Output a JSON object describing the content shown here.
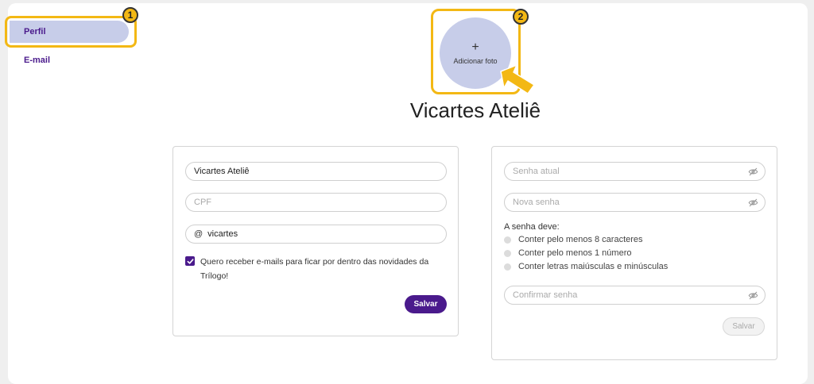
{
  "sidebar": {
    "items": [
      {
        "label": "Perfil"
      },
      {
        "label": "E-mail"
      }
    ]
  },
  "annotations": {
    "badge_1": "1",
    "badge_2": "2"
  },
  "avatar": {
    "plus": "+",
    "add_label": "Adicionar foto"
  },
  "profile": {
    "name": "Vicartes Ateliê"
  },
  "profile_form": {
    "name_value": "Vicartes Ateliê",
    "cpf_placeholder": "CPF",
    "username_prefix": "@",
    "username_value": "vicartes",
    "newsletter_checked": true,
    "newsletter_label": "Quero receber e-mails para ficar por dentro das novidades da Trílogo!",
    "save_label": "Salvar"
  },
  "password_form": {
    "current_placeholder": "Senha atual",
    "new_placeholder": "Nova senha",
    "rules_title": "A senha deve:",
    "rules": [
      {
        "label": "Conter pelo menos 8 caracteres"
      },
      {
        "label": "Conter pelo menos 1 número"
      },
      {
        "label": "Conter letras maiúsculas e minúsculas"
      }
    ],
    "confirm_placeholder": "Confirmar senha",
    "save_label": "Salvar"
  },
  "colors": {
    "accent": "#4a1a8c",
    "highlight": "#f3b814",
    "avatar_bg": "#c7cde9",
    "active_nav_bg": "#c7cde9"
  },
  "icons": {
    "eye": "eye-off-icon",
    "check": "checkmark-icon",
    "pointer": "arrow-pointer-icon"
  }
}
